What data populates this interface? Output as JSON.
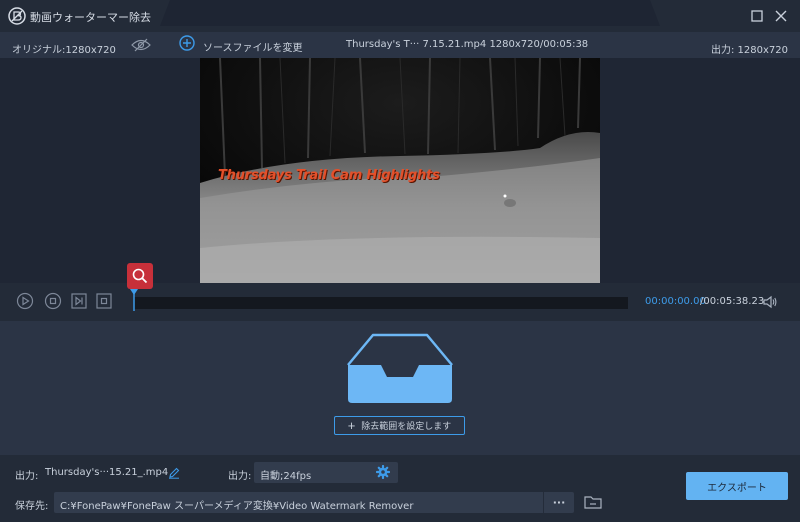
{
  "window": {
    "title": "動画ウォーターマー除去"
  },
  "infobar": {
    "original_label": "オリジナル:1280x720",
    "change_source_label": "ソースファイルを変更",
    "file_meta": "Thursday's T··· 7.15.21.mp4    1280x720/00:05:38",
    "output_label": "出力: 1280x720"
  },
  "video": {
    "overlay_text": "Thursdays Trail Cam Highlights"
  },
  "playback": {
    "current_time": "00:00:00.00",
    "total_time": "/00:05:38.23"
  },
  "main": {
    "set_range_label": "除去範囲を設定します"
  },
  "bottom": {
    "output_name_label": "出力:",
    "output_name_value": "Thursday's···15.21_.mp4",
    "output_format_label": "出力:",
    "output_format_value": "自動;24fps",
    "save_label": "保存先:",
    "save_path": "C:¥FonePaw¥FonePaw スーパーメディア変換¥Video Watermark Remover",
    "more_label": "···",
    "export_label": "エクスポート"
  },
  "colors": {
    "accent": "#3d9be9",
    "export_button": "#63b3f2",
    "marker_red": "#c7303a",
    "overlay_text": "#e4502a"
  }
}
